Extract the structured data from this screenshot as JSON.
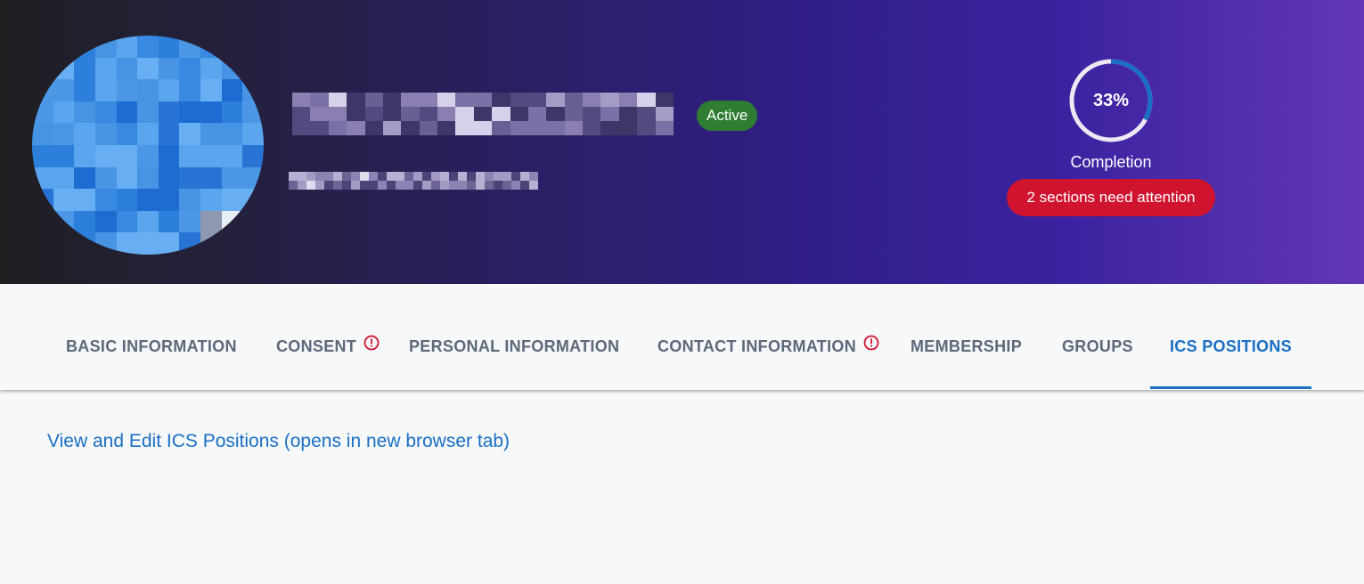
{
  "header": {
    "status_badge": "Active",
    "completion": {
      "percent": 33,
      "percent_label": "33%",
      "label": "Completion",
      "attention": "2 sections need attention"
    },
    "colors": {
      "status_green": "#2e7d32",
      "attention_red": "#d0132f",
      "ring_progress": "#1a6fc4",
      "ring_track": "#ece8f4"
    }
  },
  "tabs": [
    {
      "label": "BASIC INFORMATION",
      "alert": false,
      "active": false
    },
    {
      "label": "CONSENT",
      "alert": true,
      "active": false
    },
    {
      "label": "PERSONAL INFORMATION",
      "alert": false,
      "active": false
    },
    {
      "label": "CONTACT INFORMATION",
      "alert": true,
      "active": false
    },
    {
      "label": "MEMBERSHIP",
      "alert": false,
      "active": false
    },
    {
      "label": "GROUPS",
      "alert": false,
      "active": false
    },
    {
      "label": "ICS POSITIONS",
      "alert": false,
      "active": true
    }
  ],
  "icons": {
    "tab_alert": "alert-circle-icon"
  },
  "content": {
    "link_text": "View and Edit ICS Positions (opens in new browser tab)"
  },
  "accent_color": "#1a6fc4"
}
